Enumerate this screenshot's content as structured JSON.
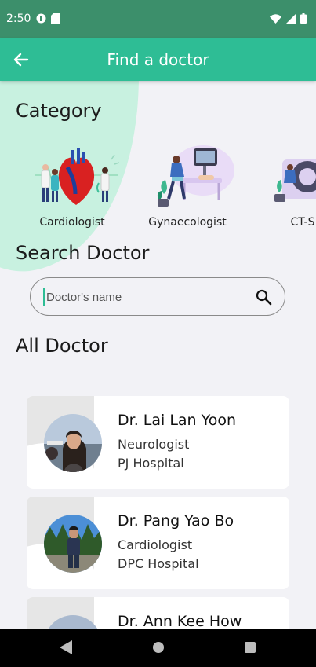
{
  "status_bar": {
    "time": "2:50"
  },
  "app_bar": {
    "title": "Find a doctor"
  },
  "sections": {
    "category": "Category",
    "search": "Search Doctor",
    "all_doctors": "All Doctor"
  },
  "categories": [
    {
      "label": "Cardiologist",
      "icon": "cardiology-illustration"
    },
    {
      "label": "Gynaecologist",
      "icon": "gynaecology-illustration"
    },
    {
      "label": "CT-S",
      "icon": "ct-scan-illustration"
    }
  ],
  "search": {
    "placeholder": "Doctor's name"
  },
  "doctors": [
    {
      "name": "Dr. Lai Lan Yoon",
      "specialty": "Neurologist",
      "hospital": "PJ Hospital"
    },
    {
      "name": "Dr. Pang Yao Bo",
      "specialty": "Cardiologist",
      "hospital": "DPC Hospital"
    },
    {
      "name": "Dr. Ann Kee How",
      "specialty": "",
      "hospital": ""
    }
  ],
  "colors": {
    "status_bar": "#3c8f6b",
    "app_bar": "#2ebd95",
    "background": "#f2f2f6",
    "blob": "#c8f1e0"
  }
}
